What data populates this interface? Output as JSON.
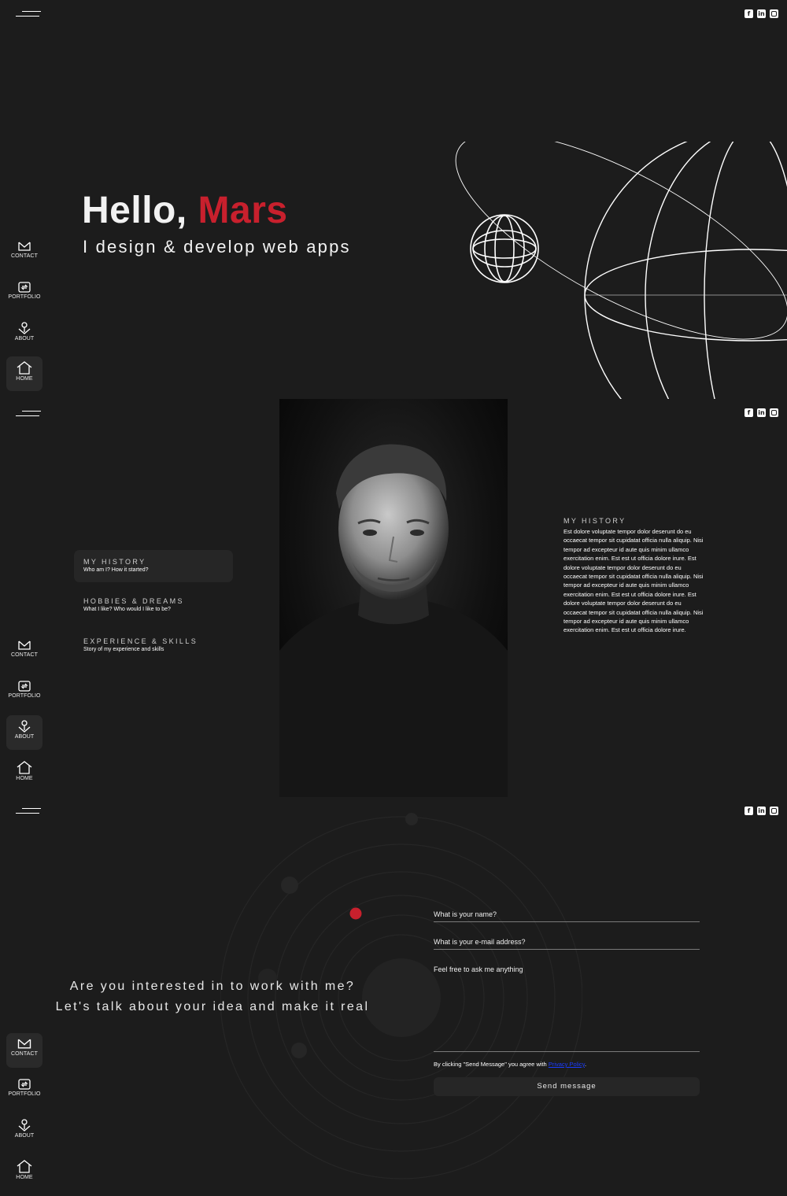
{
  "socials": [
    {
      "icon": "facebook-icon",
      "glyph": "f"
    },
    {
      "icon": "linkedin-icon",
      "glyph": "in"
    },
    {
      "icon": "instagram-icon",
      "glyph": ""
    }
  ],
  "nav": {
    "contact": "CONTACT",
    "portfolio": "PORTFOLIO",
    "about": "ABOUT",
    "home": "HOME"
  },
  "home": {
    "greeting": "Hello,",
    "name": "Mars",
    "subtitle": "I design & develop web apps"
  },
  "about": {
    "menu": [
      {
        "title": "MY HISTORY",
        "subtitle": "Who am I? How it started?",
        "active": true
      },
      {
        "title": "HOBBIES & DREAMS",
        "subtitle": "What I like? Who would I like to be?",
        "active": false
      },
      {
        "title": "EXPERIENCE & SKILLS",
        "subtitle": "Story of my experience and skills",
        "active": false
      }
    ],
    "history_title": "MY HISTORY",
    "history_body": "Est dolore voluptate tempor dolor deserunt do eu occaecat tempor sit cupidatat officia nulla aliquip. Nisi tempor ad excepteur id aute quis minim ullamco exercitation enim. Est est ut officia dolore irure. Est dolore voluptate tempor dolor deserunt do eu occaecat tempor sit cupidatat officia nulla aliquip. Nisi tempor ad excepteur id aute quis minim ullamco exercitation enim. Est est ut officia dolore irure. Est dolore voluptate tempor dolor deserunt do eu occaecat tempor sit cupidatat officia nulla aliquip. Nisi tempor ad excepteur id aute quis minim ullamco exercitation enim. Est est ut officia dolore irure."
  },
  "contact": {
    "line1": "Are you interested in to work with me?",
    "line2": "Let's talk about your idea and make it real",
    "name_placeholder": "What is your name?",
    "email_placeholder": "What is your e-mail address?",
    "message_placeholder": "Feel free to ask me anything",
    "agree_prefix": "By clicking \"Send Message\" you agree with ",
    "agree_link": "Privacy Policy",
    "agree_suffix": ".",
    "send_label": "Send message"
  },
  "colors": {
    "background": "#1c1c1c",
    "accent": "#c8202d",
    "link": "#1a3cff"
  }
}
